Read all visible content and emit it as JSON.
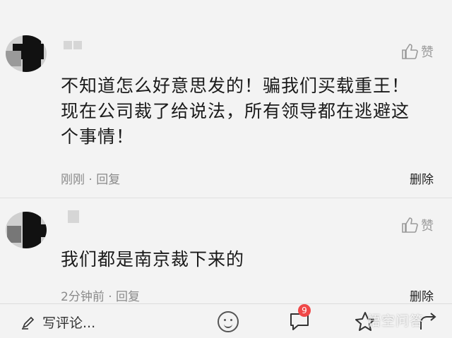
{
  "comments": [
    {
      "text_lines": [
        "不知道怎么好意思发的！骗我们买载重王！",
        "现在公司裁了给说法，所有领导都在逃避这",
        "个事情！"
      ],
      "time": "刚刚",
      "reply_label": "回复",
      "like_label": "赞",
      "delete_label": "删除"
    },
    {
      "text_lines": [
        "我们都是南京裁下来的"
      ],
      "time": "2分钟前",
      "reply_label": "回复",
      "like_label": "赞",
      "delete_label": "删除"
    }
  ],
  "bottom_bar": {
    "write_placeholder": "写评论...",
    "comment_count_badge": "9",
    "icons": [
      "pencil-icon",
      "emoji-icon",
      "comment-icon",
      "favorite-star-icon",
      "share-icon"
    ]
  },
  "watermark": "悟空问答",
  "colors": {
    "background": "#f3f3f3",
    "text": "#1a1a1a",
    "meta_text": "#8a8a8a",
    "badge": "#f04848"
  }
}
